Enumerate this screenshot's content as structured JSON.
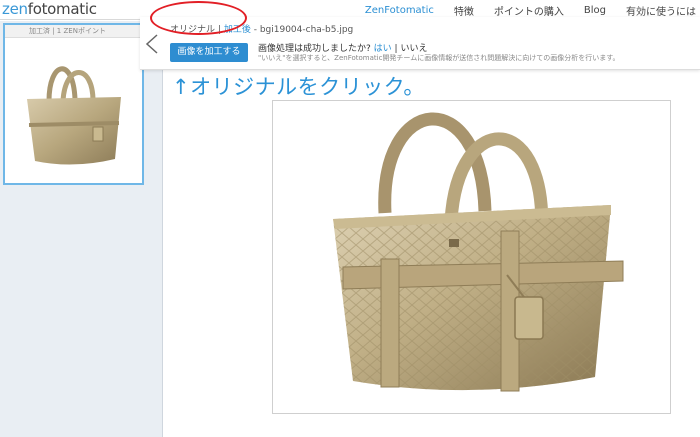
{
  "header": {
    "logo_part1": "zen",
    "logo_part2": "fotomatic",
    "nav": [
      {
        "label": "ZenFotomatic",
        "active": true
      },
      {
        "label": "特徴",
        "active": false
      },
      {
        "label": "ポイントの購入",
        "active": false
      },
      {
        "label": "Blog",
        "active": false
      },
      {
        "label": "有効に使うには",
        "active": false
      }
    ]
  },
  "thumbnail": {
    "header_text": "加工済 | 1 ZENポイント"
  },
  "popup": {
    "tab_original": "オリジナル",
    "separator": "|",
    "tab_processed": "加工後",
    "dash": "-",
    "filename": "bgi19004-cha-b5.jpg",
    "process_button": "画像を加工する",
    "question": "画像処理は成功しましたか?",
    "yes": "はい",
    "bar": "|",
    "no": "いいえ",
    "note": "\"いいえ\"を選択すると、ZenFotomatic開発チームに画像情報が送信され問題解決に向けての画像分析を行います。"
  },
  "annotation": {
    "hint": "↑オリジナルをクリック。",
    "circle_color": "#e21f26"
  },
  "colors": {
    "brand": "#3a98d6",
    "button": "#2e8dd1"
  }
}
